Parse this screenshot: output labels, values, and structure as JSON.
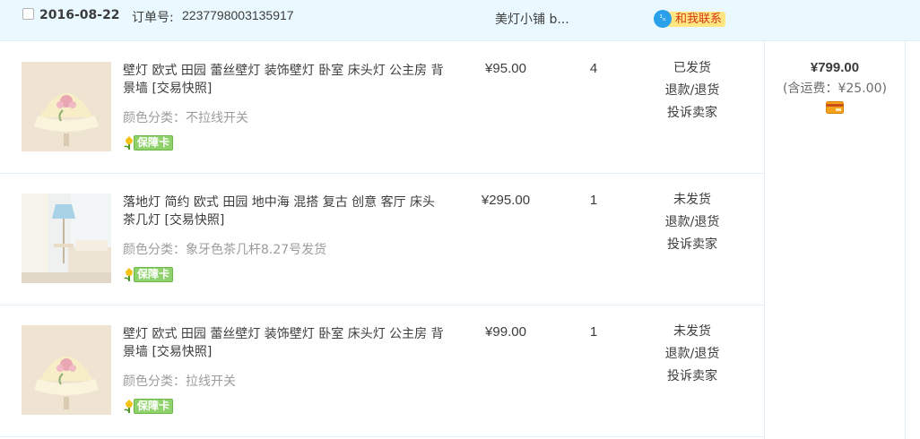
{
  "order": {
    "date": "2016-08-22",
    "order_no_label": "订单号:",
    "order_no": "2237798003135917",
    "shop": "美灯小铺 b...",
    "contact_label": "和我联系",
    "contact_badge": "¹ₒ"
  },
  "items": [
    {
      "title": "壁灯 欧式 田园 蕾丝壁灯 装饰壁灯 卧室 床头灯 公主房 背景墙 [交易快照]",
      "variant": "颜色分类：不拉线开关",
      "guarantee": "保障卡",
      "price": "¥95.00",
      "qty": "4",
      "status": "已发货",
      "refund": "退款/退货",
      "complain": "投诉卖家"
    },
    {
      "title": "落地灯 简约 欧式 田园 地中海 混搭 复古 创意 客厅 床头 茶几灯 [交易快照]",
      "variant": "颜色分类：象牙色茶几杆8.27号发货",
      "guarantee": "保障卡",
      "price": "¥295.00",
      "qty": "1",
      "status": "未发货",
      "refund": "退款/退货",
      "complain": "投诉卖家"
    },
    {
      "title": "壁灯 欧式 田园 蕾丝壁灯 装饰壁灯 卧室 床头灯 公主房 背景墙 [交易快照]",
      "variant": "颜色分类：拉线开关",
      "guarantee": "保障卡",
      "price": "¥99.00",
      "qty": "1",
      "status": "未发货",
      "refund": "退款/退货",
      "complain": "投诉卖家"
    }
  ],
  "summary": {
    "total": "¥799.00",
    "shipping": "(含运费：¥25.00)"
  },
  "icons": {
    "checkbox": "checkbox-icon",
    "contact": "wangwang-chat-icon",
    "guarantee": "tulip-guarantee-icon",
    "payment": "wallet-card-icon"
  },
  "colors": {
    "header_bg": "#eaf8ff",
    "contact_text": "#d4371b",
    "contact_bg": "#ffe680",
    "guarantee_bg": "#8fd16a"
  }
}
